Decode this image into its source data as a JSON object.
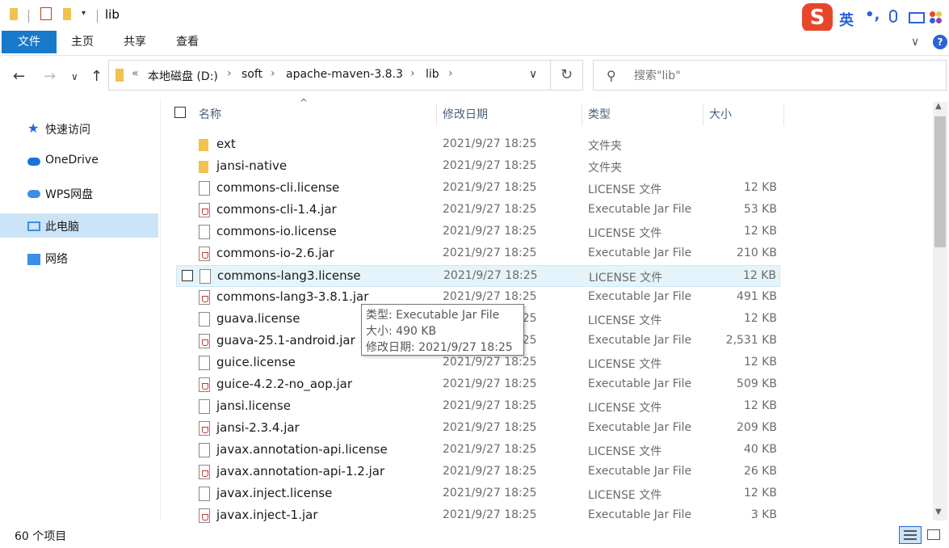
{
  "window": {
    "title": "lib"
  },
  "ime": {
    "logo": "S",
    "language": "英",
    "punct": "•,"
  },
  "ribbon": {
    "tabs": [
      "文件",
      "主页",
      "共享",
      "查看"
    ]
  },
  "address": {
    "crumb_prefix": "«",
    "crumbs": [
      "本地磁盘 (D:)",
      "soft",
      "apache-maven-3.8.3",
      "lib"
    ]
  },
  "search": {
    "placeholder": "搜索\"lib\""
  },
  "navpane": {
    "items": [
      {
        "label": "快速访问",
        "icon": "star-icon"
      },
      {
        "label": "OneDrive",
        "icon": "cloud-icon"
      },
      {
        "label": "WPS网盘",
        "icon": "wps-cloud-icon"
      },
      {
        "label": "此电脑",
        "icon": "computer-icon",
        "selected": true
      },
      {
        "label": "网络",
        "icon": "network-icon"
      }
    ]
  },
  "columns": {
    "name": "名称",
    "date": "修改日期",
    "type": "类型",
    "size": "大小"
  },
  "files": [
    {
      "name": "ext",
      "date": "2021/9/27 18:25",
      "type": "文件夹",
      "size": "",
      "icon": "folder"
    },
    {
      "name": "jansi-native",
      "date": "2021/9/27 18:25",
      "type": "文件夹",
      "size": "",
      "icon": "folder"
    },
    {
      "name": "commons-cli.license",
      "date": "2021/9/27 18:25",
      "type": "LICENSE 文件",
      "size": "12 KB",
      "icon": "doc"
    },
    {
      "name": "commons-cli-1.4.jar",
      "date": "2021/9/27 18:25",
      "type": "Executable Jar File",
      "size": "53 KB",
      "icon": "jar"
    },
    {
      "name": "commons-io.license",
      "date": "2021/9/27 18:25",
      "type": "LICENSE 文件",
      "size": "12 KB",
      "icon": "doc"
    },
    {
      "name": "commons-io-2.6.jar",
      "date": "2021/9/27 18:25",
      "type": "Executable Jar File",
      "size": "210 KB",
      "icon": "jar"
    },
    {
      "name": "commons-lang3.license",
      "date": "2021/9/27 18:25",
      "type": "LICENSE 文件",
      "size": "12 KB",
      "icon": "doc",
      "hover": true
    },
    {
      "name": "commons-lang3-3.8.1.jar",
      "date": "2021/9/27 18:25",
      "type": "Executable Jar File",
      "size": "491 KB",
      "icon": "jar"
    },
    {
      "name": "guava.license",
      "date": "2021/9/27 18:25",
      "type": "LICENSE 文件",
      "size": "12 KB",
      "icon": "doc"
    },
    {
      "name": "guava-25.1-android.jar",
      "date": "2021/9/27 18:25",
      "type": "Executable Jar File",
      "size": "2,531 KB",
      "icon": "jar"
    },
    {
      "name": "guice.license",
      "date": "2021/9/27 18:25",
      "type": "LICENSE 文件",
      "size": "12 KB",
      "icon": "doc"
    },
    {
      "name": "guice-4.2.2-no_aop.jar",
      "date": "2021/9/27 18:25",
      "type": "Executable Jar File",
      "size": "509 KB",
      "icon": "jar"
    },
    {
      "name": "jansi.license",
      "date": "2021/9/27 18:25",
      "type": "LICENSE 文件",
      "size": "12 KB",
      "icon": "doc"
    },
    {
      "name": "jansi-2.3.4.jar",
      "date": "2021/9/27 18:25",
      "type": "Executable Jar File",
      "size": "209 KB",
      "icon": "jar"
    },
    {
      "name": "javax.annotation-api.license",
      "date": "2021/9/27 18:25",
      "type": "LICENSE 文件",
      "size": "40 KB",
      "icon": "doc"
    },
    {
      "name": "javax.annotation-api-1.2.jar",
      "date": "2021/9/27 18:25",
      "type": "Executable Jar File",
      "size": "26 KB",
      "icon": "jar"
    },
    {
      "name": "javax.inject.license",
      "date": "2021/9/27 18:25",
      "type": "LICENSE 文件",
      "size": "12 KB",
      "icon": "doc"
    },
    {
      "name": "javax.inject-1.jar",
      "date": "2021/9/27 18:25",
      "type": "Executable Jar File",
      "size": "3 KB",
      "icon": "jar"
    }
  ],
  "tooltip": {
    "type_line": "类型: Executable Jar File",
    "size_line": "大小: 490 KB",
    "date_line": "修改日期: 2021/9/27 18:25"
  },
  "status": {
    "item_count": "60 个项目"
  }
}
